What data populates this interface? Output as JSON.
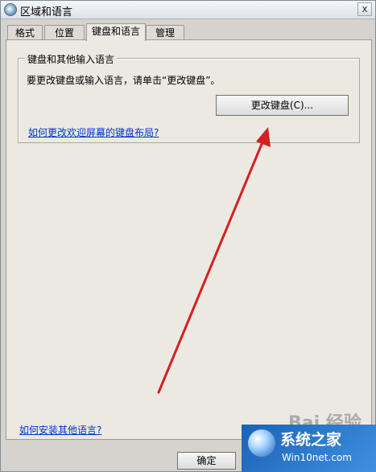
{
  "window": {
    "title": "区域和语言",
    "close_label": "x"
  },
  "tabs": [
    {
      "label": "格式"
    },
    {
      "label": "位置"
    },
    {
      "label": "键盘和语言"
    },
    {
      "label": "管理"
    }
  ],
  "keyboard_group": {
    "legend": "键盘和其他输入语言",
    "instruction": "要更改键盘或输入语言，请单击“更改键盘”。",
    "change_button": "更改键盘(C)...",
    "welcome_link": "如何更改欢迎屏幕的键盘布局?"
  },
  "install_link": "如何安装其他语言?",
  "footer": {
    "ok_button": "确定"
  },
  "watermark": {
    "brand": "系统之家",
    "url": "Win10net.com",
    "baidu_text": "Bai 经验"
  },
  "colors": {
    "annotation_arrow": "#d42020",
    "link": "#0033cc",
    "dialog_bg": "#ece9e2"
  }
}
